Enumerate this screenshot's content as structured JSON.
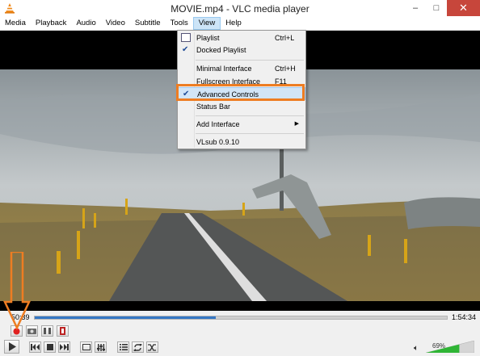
{
  "window": {
    "title": "MOVIE.mp4 - VLC media player",
    "minimize": "–",
    "maximize": "□",
    "close": "✕"
  },
  "menubar": {
    "items": [
      "Media",
      "Playback",
      "Audio",
      "Video",
      "Subtitle",
      "Tools",
      "View",
      "Help"
    ],
    "active": "View"
  },
  "view_menu": {
    "items": [
      {
        "label": "Playlist",
        "shortcut": "Ctrl+L",
        "icon": "playlist-icon"
      },
      {
        "label": "Docked Playlist",
        "checked": true
      },
      {
        "label": "Minimal Interface",
        "shortcut": "Ctrl+H"
      },
      {
        "label": "Fullscreen Interface",
        "shortcut": "F11"
      },
      {
        "label": "Advanced Controls",
        "checked": true,
        "highlighted": true
      },
      {
        "label": "Status Bar"
      },
      {
        "label": "Add Interface",
        "submenu": true
      },
      {
        "label": "VLsub 0.9.10"
      }
    ]
  },
  "player": {
    "elapsed": "50:39",
    "total": "1:54:34",
    "progress_fraction": 0.44,
    "volume": "69%",
    "volume_fraction": 0.69
  },
  "colors": {
    "accent": "#3577c4",
    "annotation": "#ee7d22",
    "record": "#e02020",
    "volume": "#2fb535"
  }
}
